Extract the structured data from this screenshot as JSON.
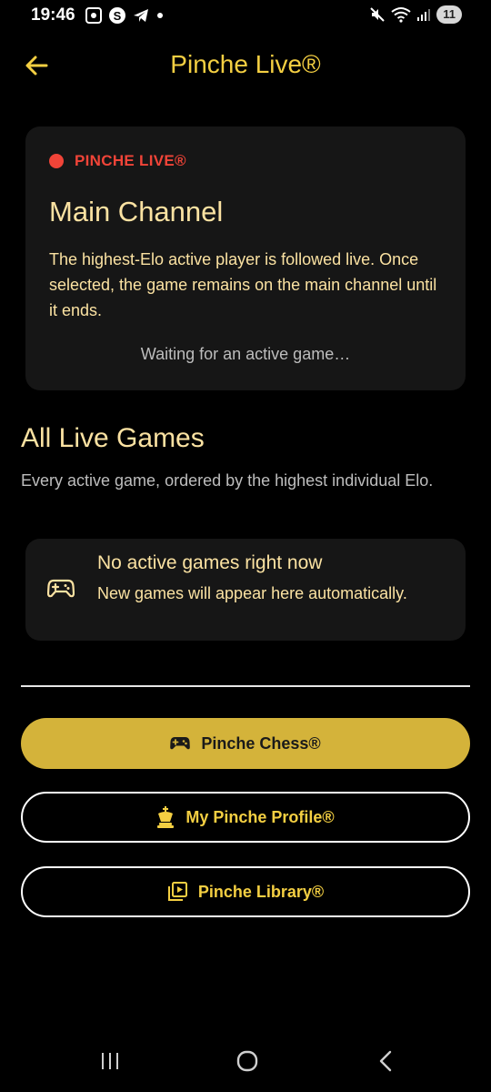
{
  "status_bar": {
    "time": "19:46",
    "battery": "11"
  },
  "app_bar": {
    "title": "Pinche Live®"
  },
  "main_channel": {
    "live_label": "PINCHE LIVE®",
    "title": "Main Channel",
    "description": "The highest-Elo active player is followed live. Once selected, the game remains on the main channel until it ends.",
    "waiting_text": "Waiting for an active game…"
  },
  "all_live_games": {
    "title": "All Live Games",
    "description": "Every active game, ordered by the highest individual Elo.",
    "empty_title": "No active games right now",
    "empty_description": "New games will appear here automatically."
  },
  "buttons": {
    "chess": "Pinche Chess®",
    "profile": "My Pinche Profile®",
    "library": "Pinche Library®"
  },
  "colors": {
    "accent": "#f4cf42",
    "primary_button": "#d4b33a",
    "live_red": "#f04438",
    "card_bg": "#161616",
    "text_cream": "#fbe2a2"
  }
}
